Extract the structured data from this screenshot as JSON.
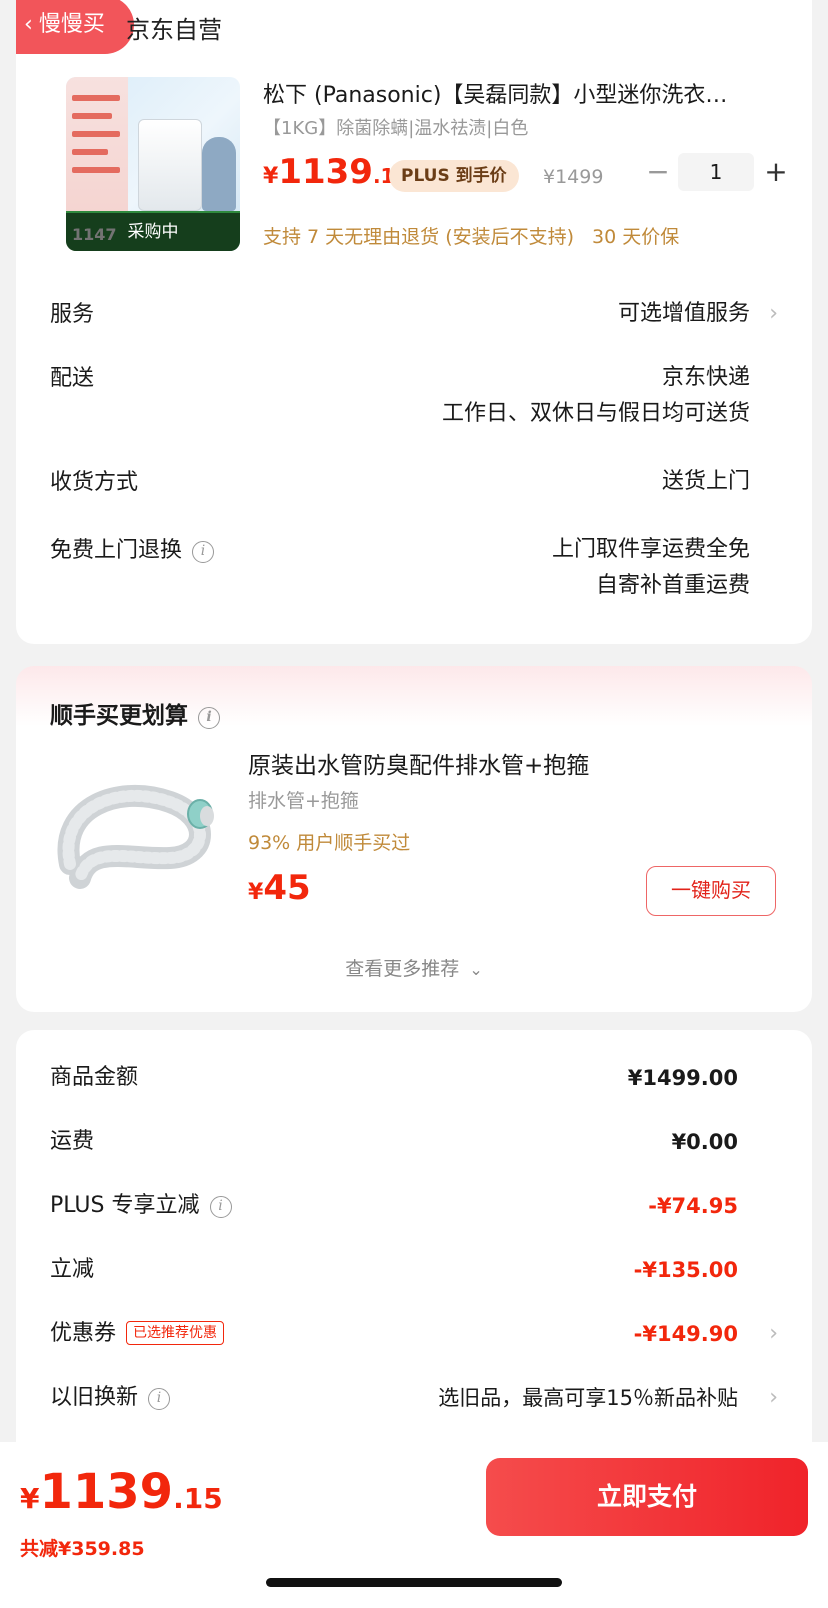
{
  "header": {
    "back_label": "慢慢买",
    "store_name": "京东自营"
  },
  "product": {
    "thumb_overlay": "采购中",
    "thumb_price_strip": "1147",
    "title": "松下 (Panasonic)【吴磊同款】小型迷你洗衣…",
    "spec": "【1KG】除菌除螨|温水祛渍|白色",
    "price_yen": "¥",
    "price_int": "1139",
    "price_dec": ".15",
    "plus_tag": "PLUS 到手价",
    "original_price": "¥1499",
    "quantity": "1",
    "qty_minus": "−",
    "qty_plus": "+",
    "policy_return": "支持 7 天无理由退货 (安装后不支持)",
    "policy_price": "30 天价保"
  },
  "details": {
    "service_label": "服务",
    "service_value": "可选增值服务",
    "delivery_label": "配送",
    "delivery_line1": "京东快递",
    "delivery_line2": "工作日、双休日与假日均可送货",
    "receive_label": "收货方式",
    "receive_value": "送货上门",
    "exchange_label": "免费上门退换",
    "exchange_line1": "上门取件享运费全免",
    "exchange_line2": "自寄补首重运费"
  },
  "addon": {
    "section_title": "顺手买更划算",
    "name": "原装出水管防臭配件排水管+抱箍",
    "spec": "排水管+抱箍",
    "percent_text": "93% 用户顺手买过",
    "price_yen": "¥",
    "price_int": "45",
    "buy_button": "一键购买",
    "more_link": "查看更多推荐"
  },
  "summary": {
    "goods_label": "商品金额",
    "goods_amount": "¥1499.00",
    "shipping_label": "运费",
    "shipping_amount": "¥0.00",
    "plus_label": "PLUS 专享立减",
    "plus_amount": "-¥74.95",
    "discount_label": "立减",
    "discount_amount": "-¥135.00",
    "coupon_label": "优惠券",
    "coupon_badge": "已选推荐优惠",
    "coupon_amount": "-¥149.90",
    "tradein_label": "以旧换新",
    "tradein_value": "选旧品，最高可享15％新品补贴"
  },
  "footer": {
    "total_yen": "¥",
    "total_int": "1139",
    "total_dec": ".15",
    "total_saved": "共减¥359.85",
    "pay_button": "立即支付"
  },
  "colors": {
    "accent_red": "#f2270c",
    "pay_gradient_start": "#f54c4c",
    "pay_gradient_end": "#f0232a",
    "policy_gold": "#c08a3a"
  }
}
